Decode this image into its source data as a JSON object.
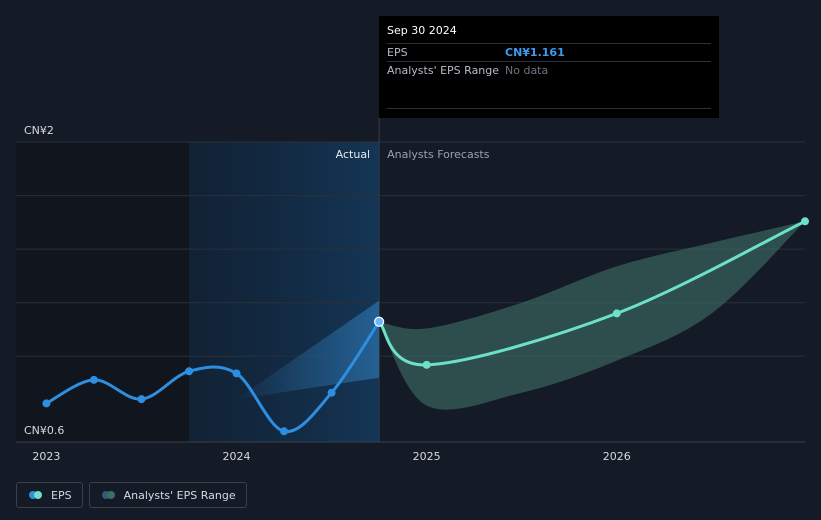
{
  "colors": {
    "background": "#151b26",
    "actual_line": "#2e8ee0",
    "forecast_line": "#6ee0c8",
    "forecast_band": "#3c6d66",
    "actual_region": "#0f2740",
    "gridline": "#2a303a",
    "axis_text": "#d5d9df",
    "section_label_forecast": "#9aa1ab"
  },
  "sections": {
    "actual_label": "Actual",
    "forecast_label": "Analysts Forecasts"
  },
  "tooltip": {
    "date": "Sep 30 2024",
    "eps_label": "EPS",
    "eps_value": "CN¥1.161",
    "range_label": "Analysts' EPS Range",
    "range_value": "No data"
  },
  "legend": {
    "eps_label": "EPS",
    "range_label": "Analysts' EPS Range",
    "eps_icon": "eps-series-icon",
    "range_icon": "eps-range-series-icon"
  },
  "chart_data": {
    "type": "line",
    "y_top_label": "CN¥2",
    "y_bottom_label": "CN¥0.6",
    "ylim": [
      0.6,
      2.0
    ],
    "x_tick_labels": [
      "2023",
      "2024",
      "2025",
      "2026"
    ],
    "x_ticks": [
      2023.0,
      2024.0,
      2025.0,
      2026.0
    ],
    "xlim": [
      2022.84,
      2026.99
    ],
    "grid": true,
    "actual_cutoff": 2024.75,
    "actual_region_start": 2023.75,
    "series": [
      {
        "name": "EPS",
        "role": "actual",
        "x": [
          2023.0,
          2023.25,
          2023.5,
          2023.75,
          2024.0,
          2024.25,
          2024.5,
          2024.75
        ],
        "y": [
          0.78,
          0.89,
          0.8,
          0.93,
          0.92,
          0.65,
          0.83,
          1.161
        ]
      },
      {
        "name": "EPS",
        "role": "forecast",
        "x": [
          2024.75,
          2025.0,
          2026.0,
          2026.99
        ],
        "y": [
          1.161,
          0.96,
          1.2,
          1.63
        ]
      },
      {
        "name": "Analysts' EPS Range",
        "role": "forecast_range",
        "x": [
          2024.75,
          2025.0,
          2025.5,
          2026.0,
          2026.5,
          2026.99
        ],
        "high": [
          1.161,
          1.13,
          1.25,
          1.42,
          1.53,
          1.63
        ],
        "low": [
          1.161,
          0.77,
          0.83,
          0.98,
          1.2,
          1.63
        ]
      },
      {
        "name": "Analysts' EPS Range",
        "role": "past_range",
        "x": [
          2024.0,
          2024.75
        ],
        "high": [
          0.8,
          1.26
        ],
        "low": [
          0.8,
          0.9
        ]
      }
    ]
  }
}
